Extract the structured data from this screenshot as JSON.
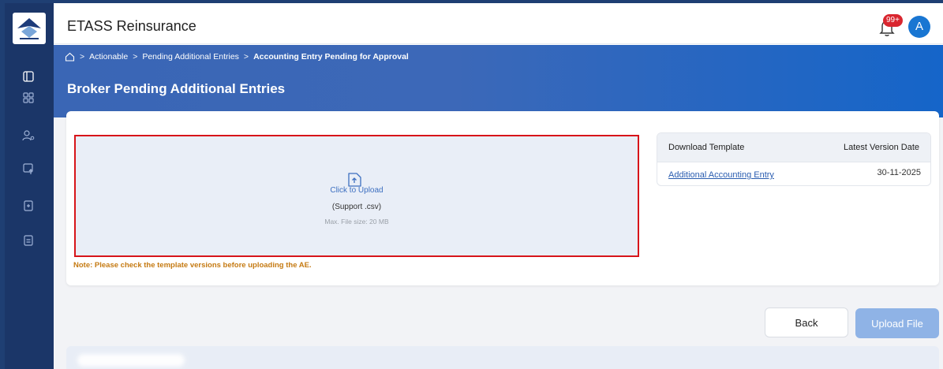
{
  "app": {
    "title": "ETASS Reinsurance"
  },
  "header": {
    "notification_badge": "99+",
    "avatar_initial": "A"
  },
  "breadcrumb": {
    "items": [
      "Actionable",
      "Pending Additional Entries",
      "Accounting Entry Pending for Approval"
    ]
  },
  "page": {
    "title": "Broker Pending Additional Entries"
  },
  "upload": {
    "label": "Click to Upload",
    "support": "(Support .csv)",
    "max_size": "Max. File size: 20 MB",
    "note": "Note: Please check the template versions before uploading the AE."
  },
  "template_table": {
    "headers": [
      "Download Template",
      "Latest Version Date"
    ],
    "rows": [
      {
        "name": "Additional Accounting Entry",
        "date": "30-11-2025"
      }
    ]
  },
  "actions": {
    "back": "Back",
    "upload_file": "Upload File"
  },
  "colors": {
    "sidebar": "#1b3668",
    "banner": "#3a66b5",
    "accent": "#1976d2",
    "highlight_border": "#d7141a",
    "note": "#c57a12"
  }
}
